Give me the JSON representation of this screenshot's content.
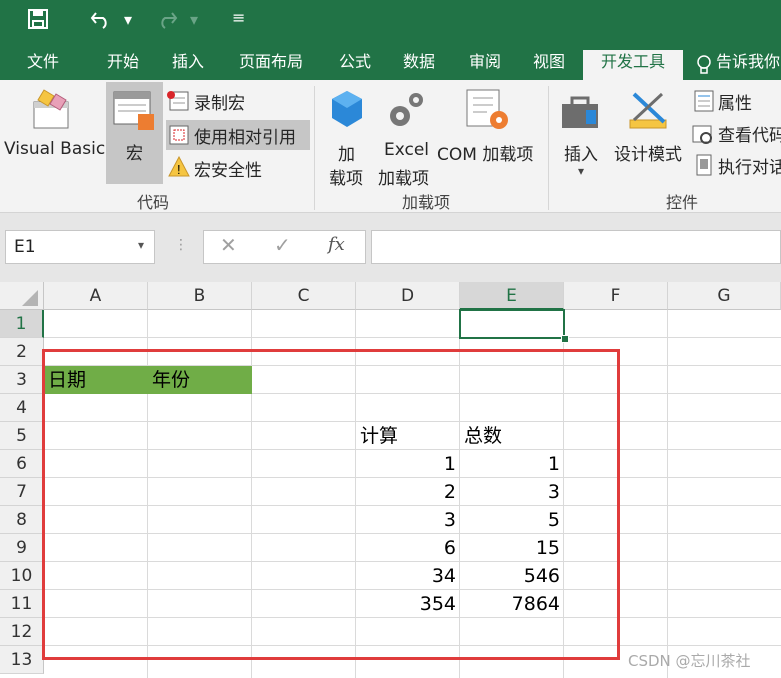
{
  "quick_access": {
    "save_icon": "save-icon",
    "undo_icon": "undo-icon",
    "redo_icon": "redo-icon"
  },
  "tabs": [
    "文件",
    "开始",
    "插入",
    "页面布局",
    "公式",
    "数据",
    "审阅",
    "视图",
    "开发工具",
    "告诉我你"
  ],
  "active_tab": "开发工具",
  "ribbon": {
    "code": {
      "visual_basic": "Visual Basic",
      "macro": "宏",
      "record": "录制宏",
      "relative": "使用相对引用",
      "security": "宏安全性",
      "group": "代码"
    },
    "addins": {
      "addin1": "加",
      "addin2": "载项",
      "excel1": "Excel",
      "excel2": "加载项",
      "com": "COM 加载项",
      "group": "加载项"
    },
    "controls": {
      "insert": "插入",
      "design": "设计模式",
      "properties": "属性",
      "view_code": "查看代码",
      "run_dialog": "执行对话",
      "group": "控件"
    }
  },
  "formula_bar": {
    "name_box": "E1",
    "fx": "fx",
    "value": ""
  },
  "columns": [
    "A",
    "B",
    "C",
    "D",
    "E",
    "F",
    "G"
  ],
  "rows": [
    "1",
    "2",
    "3",
    "4",
    "5",
    "6",
    "7",
    "8",
    "9",
    "10",
    "11",
    "12",
    "13"
  ],
  "cells": {
    "A3": "日期",
    "B3": "年份",
    "D5": "计算",
    "E5": "总数",
    "D6": "1",
    "E6": "1",
    "D7": "2",
    "E7": "3",
    "D8": "3",
    "E8": "5",
    "D9": "6",
    "E9": "15",
    "D10": "34",
    "E10": "546",
    "D11": "354",
    "E11": "7864"
  },
  "watermark": "CSDN @忘川茶社",
  "colors": {
    "excel_green": "#217346",
    "highlight_fill": "#70ad47",
    "annotation_border": "#e03c3c"
  }
}
